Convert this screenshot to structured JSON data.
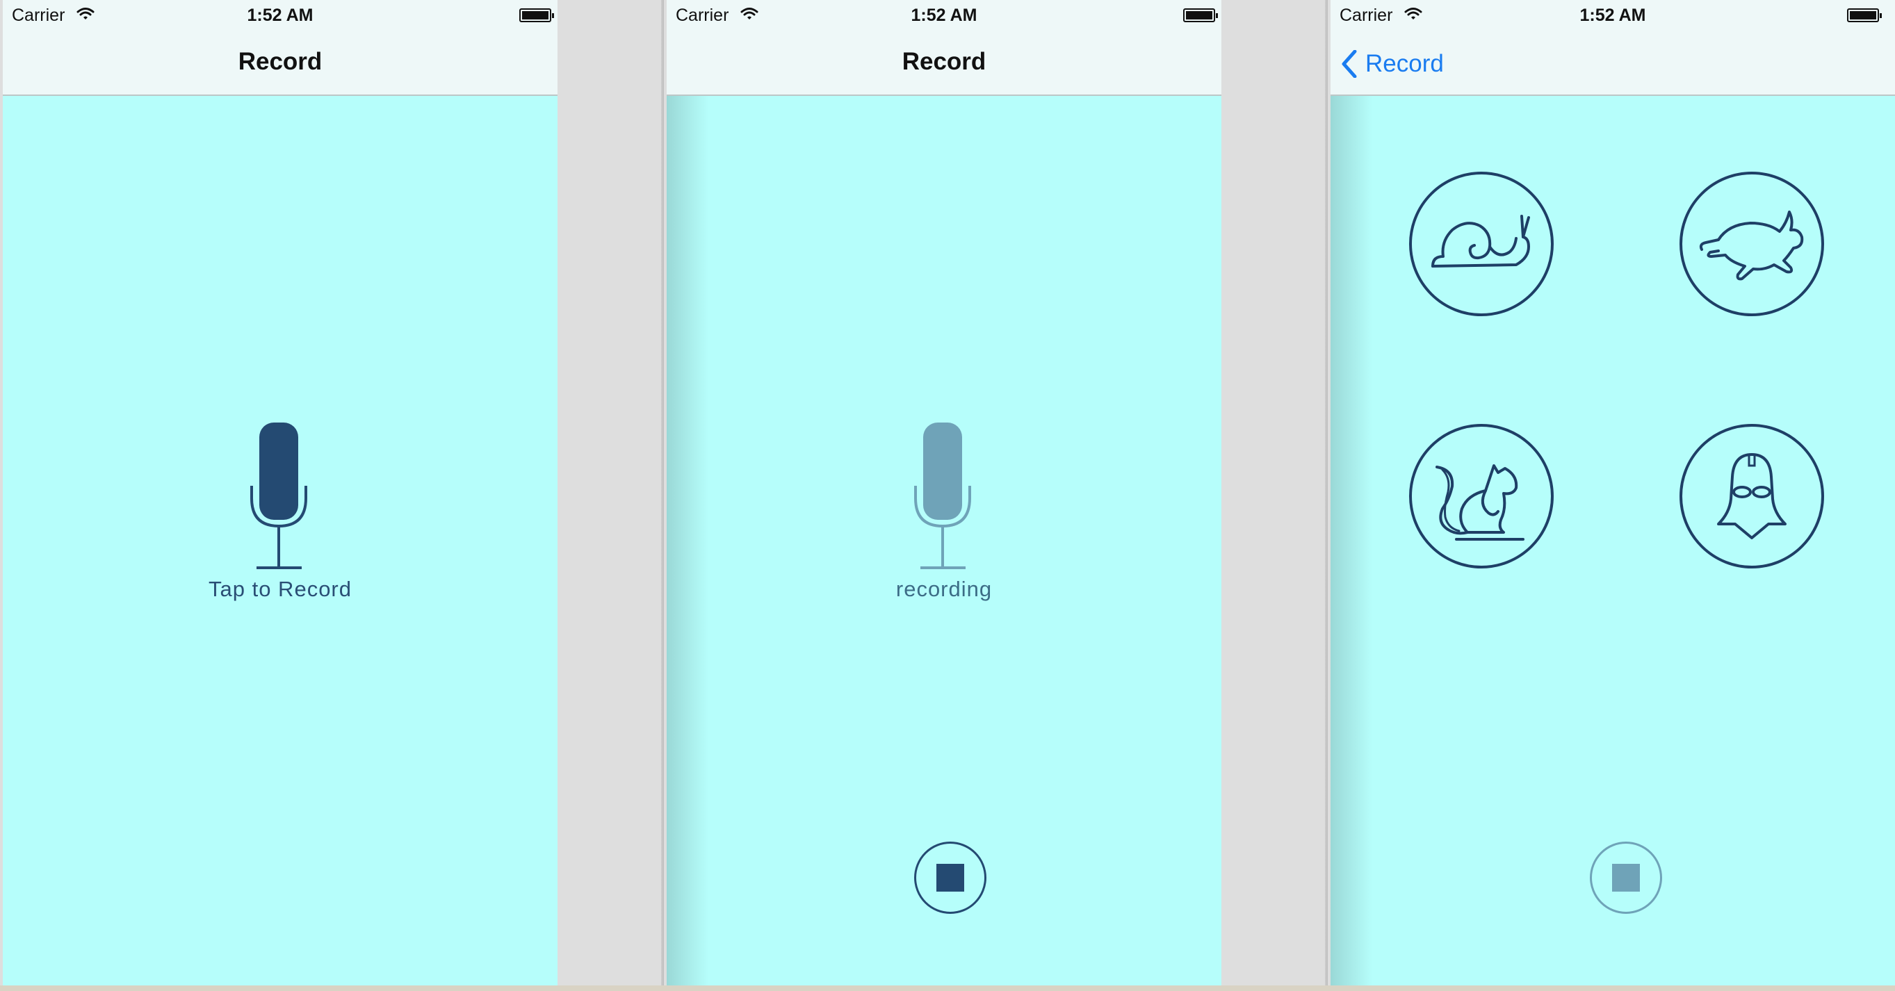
{
  "status_bar": {
    "carrier": "Carrier",
    "time": "1:52 AM"
  },
  "screens": [
    {
      "nav_title": "Record",
      "mic_label": "Tap to Record",
      "mic_state": "idle",
      "stop_button_visible": false
    },
    {
      "nav_title": "Record",
      "mic_label": "recording",
      "mic_state": "disabled",
      "stop_button_visible": true,
      "stop_button_enabled": true
    },
    {
      "back_label": "Record",
      "effects": [
        {
          "icon": "snail-icon",
          "name": "slow-effect"
        },
        {
          "icon": "rabbit-icon",
          "name": "fast-effect"
        },
        {
          "icon": "squirrel-icon",
          "name": "chipmunk-effect"
        },
        {
          "icon": "darth-vader-icon",
          "name": "vader-effect"
        }
      ],
      "stop_button_visible": true,
      "stop_button_enabled": false
    }
  ],
  "colors": {
    "screen_background": "#b6fefb",
    "bar_background": "#eef8f8",
    "icon_dark": "#1e3f66",
    "icon_disabled": "#6fa3b8",
    "link_blue": "#1a7cf0"
  }
}
